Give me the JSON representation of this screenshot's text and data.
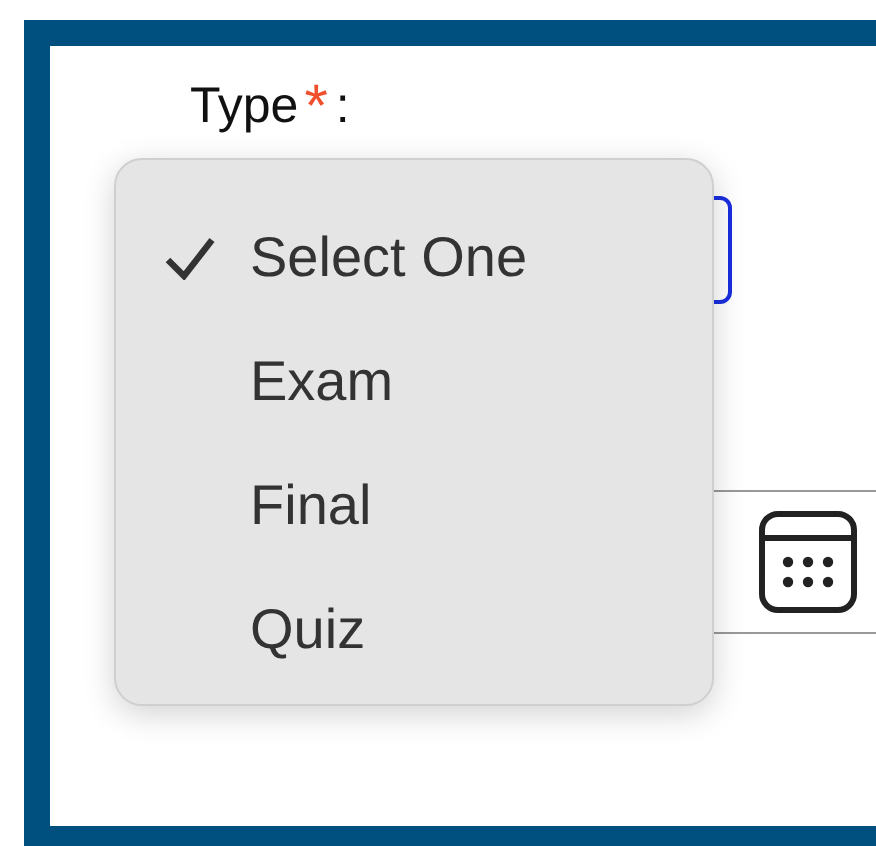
{
  "field": {
    "label": "Type",
    "required_mark": "*",
    "suffix": ":"
  },
  "menu": {
    "options": [
      {
        "label": "Select One",
        "selected": true
      },
      {
        "label": "Exam",
        "selected": false
      },
      {
        "label": "Final",
        "selected": false
      },
      {
        "label": "Quiz",
        "selected": false
      }
    ]
  }
}
